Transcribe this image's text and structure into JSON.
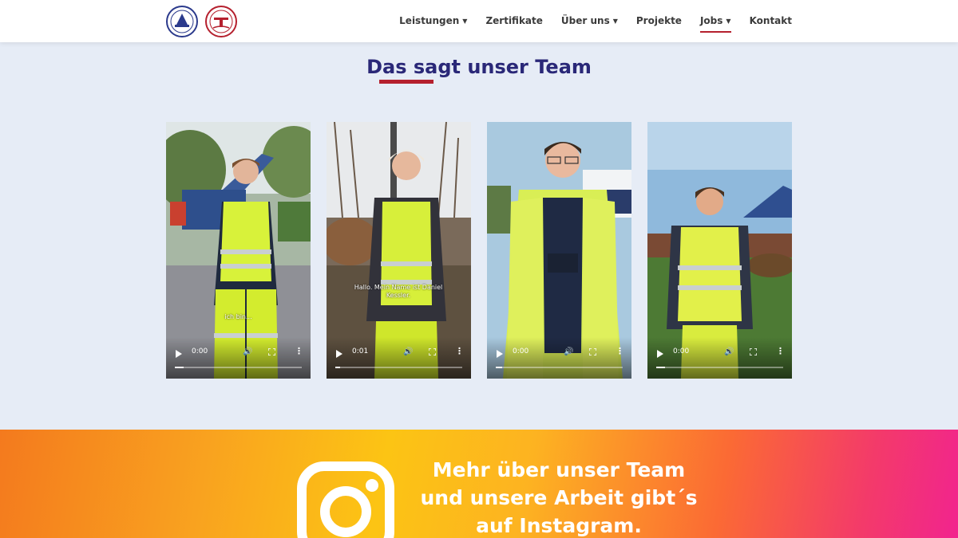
{
  "header": {
    "logos": [
      {
        "name": "company-logo-blue",
        "color": "#2b3a8c"
      },
      {
        "name": "company-logo-red",
        "color": "#b5202e"
      }
    ],
    "nav": [
      {
        "label": "Leistungen",
        "dropdown": true,
        "active": false
      },
      {
        "label": "Zertifikate",
        "dropdown": false,
        "active": false
      },
      {
        "label": "Über uns",
        "dropdown": true,
        "active": false
      },
      {
        "label": "Projekte",
        "dropdown": false,
        "active": false
      },
      {
        "label": "Jobs",
        "dropdown": true,
        "active": true
      },
      {
        "label": "Kontakt",
        "dropdown": false,
        "active": false
      }
    ]
  },
  "team_section": {
    "title": "Das sagt unser Team",
    "videos": [
      {
        "time": "0:00",
        "subtitle": "ich bin...",
        "progress": 0.07
      },
      {
        "time": "0:01",
        "subtitle": "Hallo. Mein Name ist Daniel Kessler.",
        "progress": 0.04
      },
      {
        "time": "0:00",
        "subtitle": "",
        "progress": 0.05
      },
      {
        "time": "0:00",
        "subtitle": "",
        "progress": 0.07
      }
    ]
  },
  "instagram": {
    "lines": [
      "Mehr über unser Team",
      "und unsere Arbeit gibt´s",
      "auf Instagram."
    ]
  },
  "colors": {
    "accent_red": "#b5202e",
    "title_blue": "#2a2878",
    "page_bg": "#e6ecf6"
  }
}
